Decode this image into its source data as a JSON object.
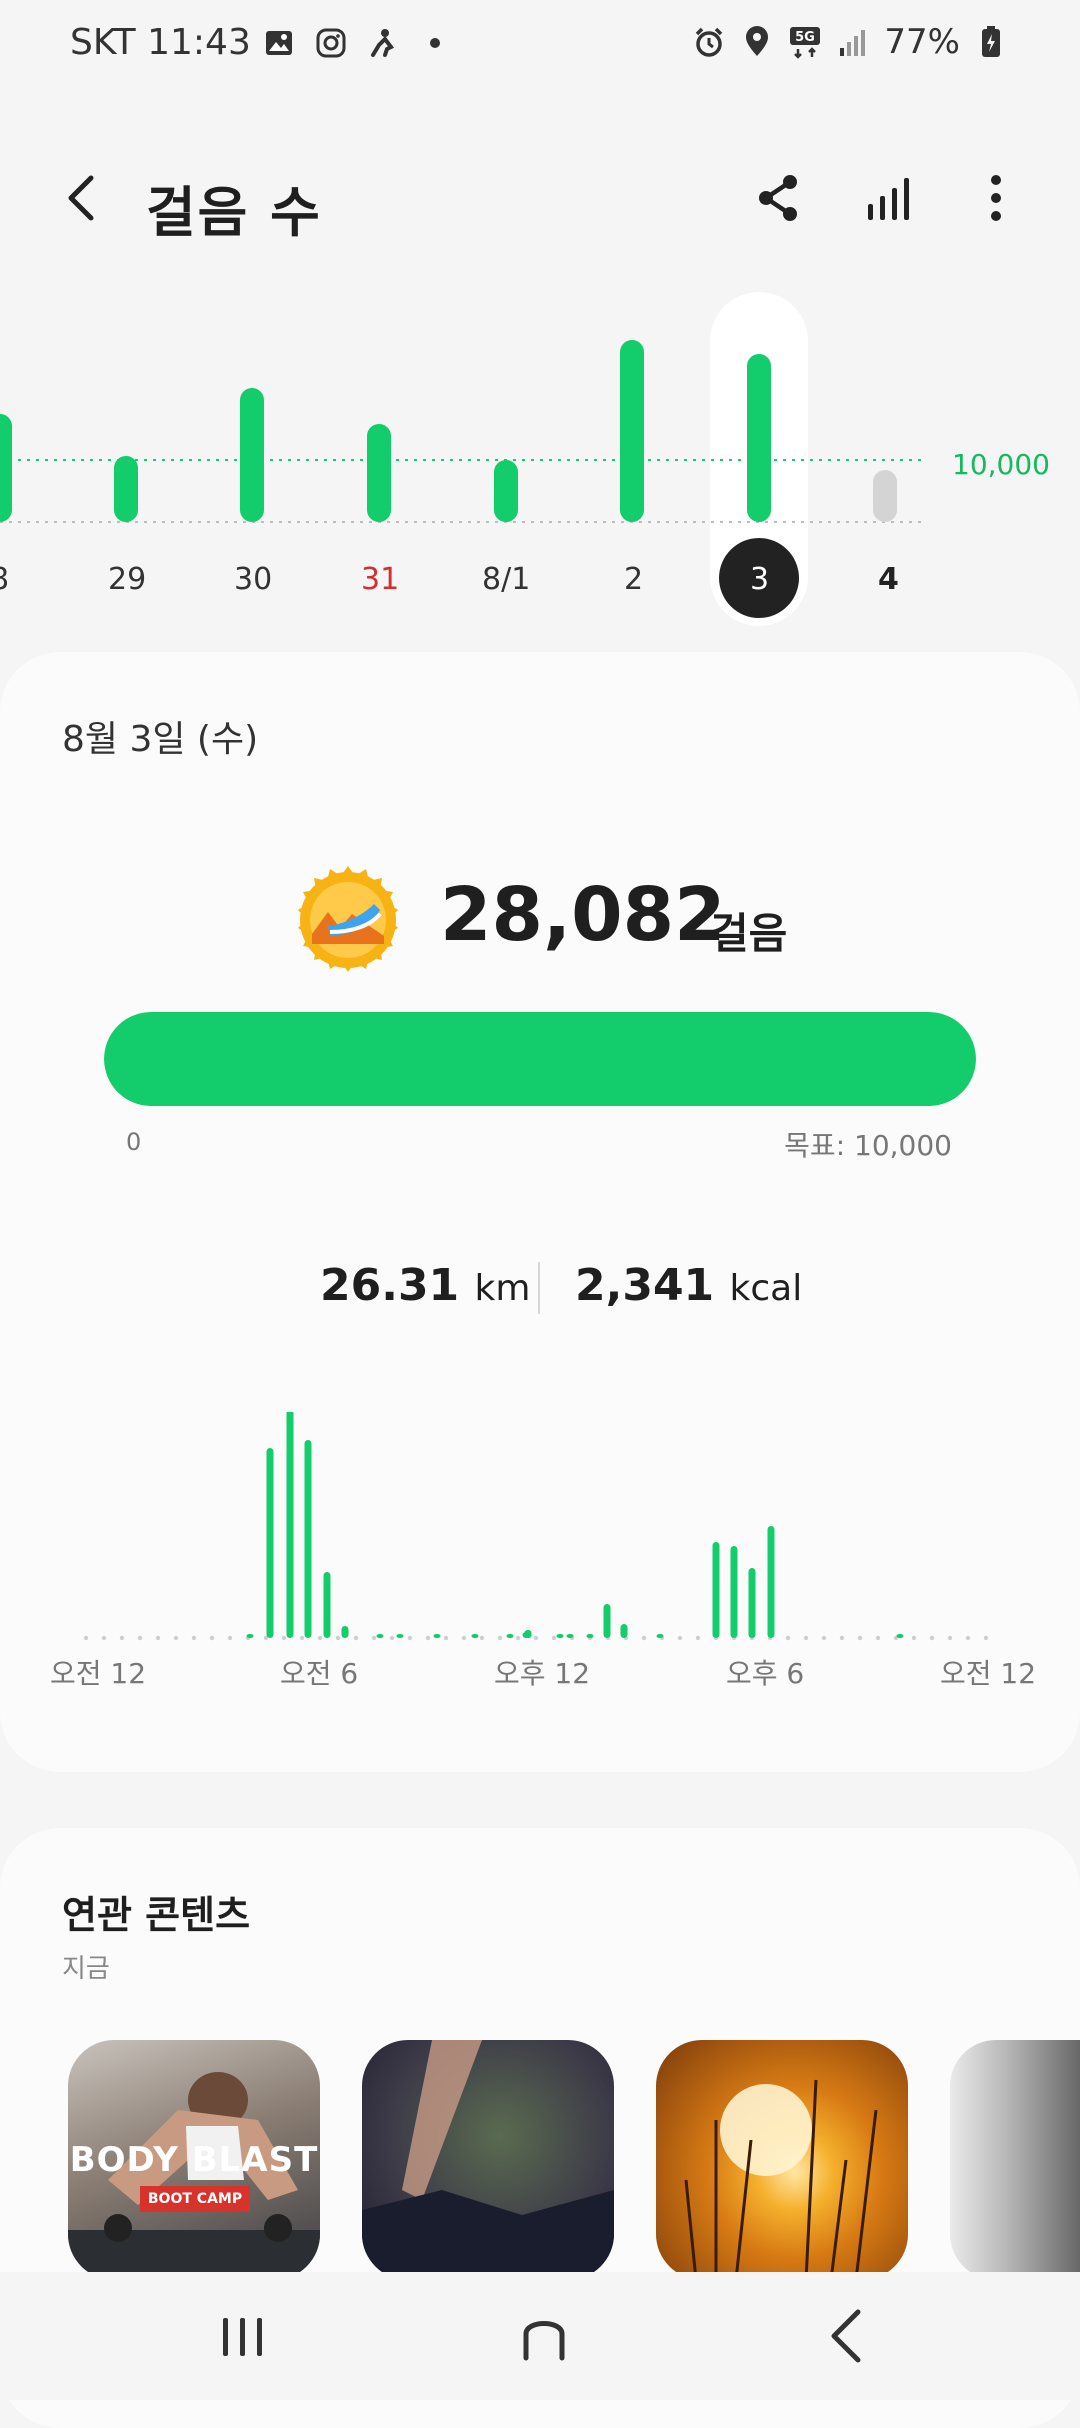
{
  "status": {
    "carrier_time": "SKT 11:43",
    "network": "5G",
    "battery": "77%"
  },
  "header": {
    "title": "걸음 수"
  },
  "weekly": {
    "goal_label": "10,000",
    "days": [
      "8",
      "29",
      "30",
      "31",
      "8/1",
      "2",
      "3",
      "4"
    ],
    "selected": "3",
    "colors": {
      "bar": "#13cc6b",
      "sunday": "#d32f2f",
      "future": "#d4d4d4",
      "selected_circle": "#222222"
    }
  },
  "summary": {
    "date": "8월 3일 (수)",
    "steps": "28,082",
    "steps_unit": "걸음",
    "progress_fraction": 1.0,
    "progress_min": "0",
    "progress_goal": "목표: 10,000",
    "distance_value": "26.31",
    "distance_unit": "km",
    "calories_value": "2,341",
    "calories_unit": "kcal",
    "accent": "#13cc6b"
  },
  "hourly_axis": [
    "오전 12",
    "오전 6",
    "오후 12",
    "오후 6",
    "오전 12"
  ],
  "related": {
    "title": "연관 콘텐츠",
    "subtitle": "지금",
    "thumb1_title": "BODY BLAST",
    "thumb1_sub": "BOOT CAMP"
  }
}
